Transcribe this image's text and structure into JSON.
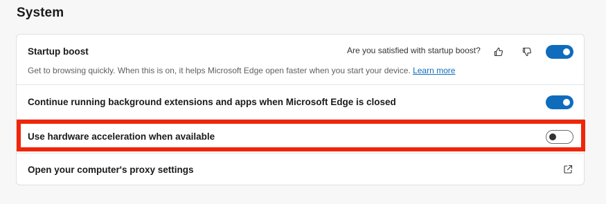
{
  "section": {
    "title": "System"
  },
  "settings": {
    "startup_boost": {
      "title": "Startup boost",
      "feedback_question": "Are you satisfied with startup boost?",
      "description": "Get to browsing quickly. When this is on, it helps Microsoft Edge open faster when you start your device.",
      "learn_more": "Learn more",
      "toggle_state": "on"
    },
    "background_apps": {
      "title": "Continue running background extensions and apps when Microsoft Edge is closed",
      "toggle_state": "on"
    },
    "hardware_acceleration": {
      "title": "Use hardware acceleration when available",
      "toggle_state": "off",
      "highlighted": true
    },
    "proxy": {
      "title": "Open your computer's proxy settings",
      "icon": "external-link-icon"
    }
  },
  "colors": {
    "accent": "#0f6cbd",
    "highlight": "#f0250a"
  }
}
